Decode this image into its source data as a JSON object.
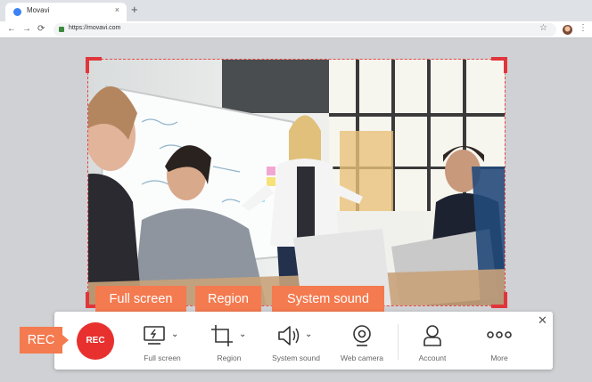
{
  "browser": {
    "tab_title": "Movavi",
    "tab_close": "×",
    "new_tab": "+",
    "url": "https://movavi.com",
    "back": "←",
    "forward": "→",
    "reload": "⟳",
    "star": "☆",
    "menu": "⋮"
  },
  "callouts": {
    "full_screen": "Full screen",
    "region": "Region",
    "system_sound": "System sound",
    "rec": "REC"
  },
  "recorder": {
    "rec_button": "REC",
    "tools": [
      {
        "label": "Full screen",
        "icon": "full-screen-icon"
      },
      {
        "label": "Region",
        "icon": "region-icon"
      },
      {
        "label": "System sound",
        "icon": "speaker-icon"
      },
      {
        "label": "Web camera",
        "icon": "webcam-icon"
      },
      {
        "label": "Account",
        "icon": "account-icon"
      },
      {
        "label": "More",
        "icon": "more-icon"
      }
    ],
    "close": "✕"
  },
  "colors": {
    "accent": "#f47a4f",
    "record": "#e8312f",
    "frame": "#e0363b"
  }
}
